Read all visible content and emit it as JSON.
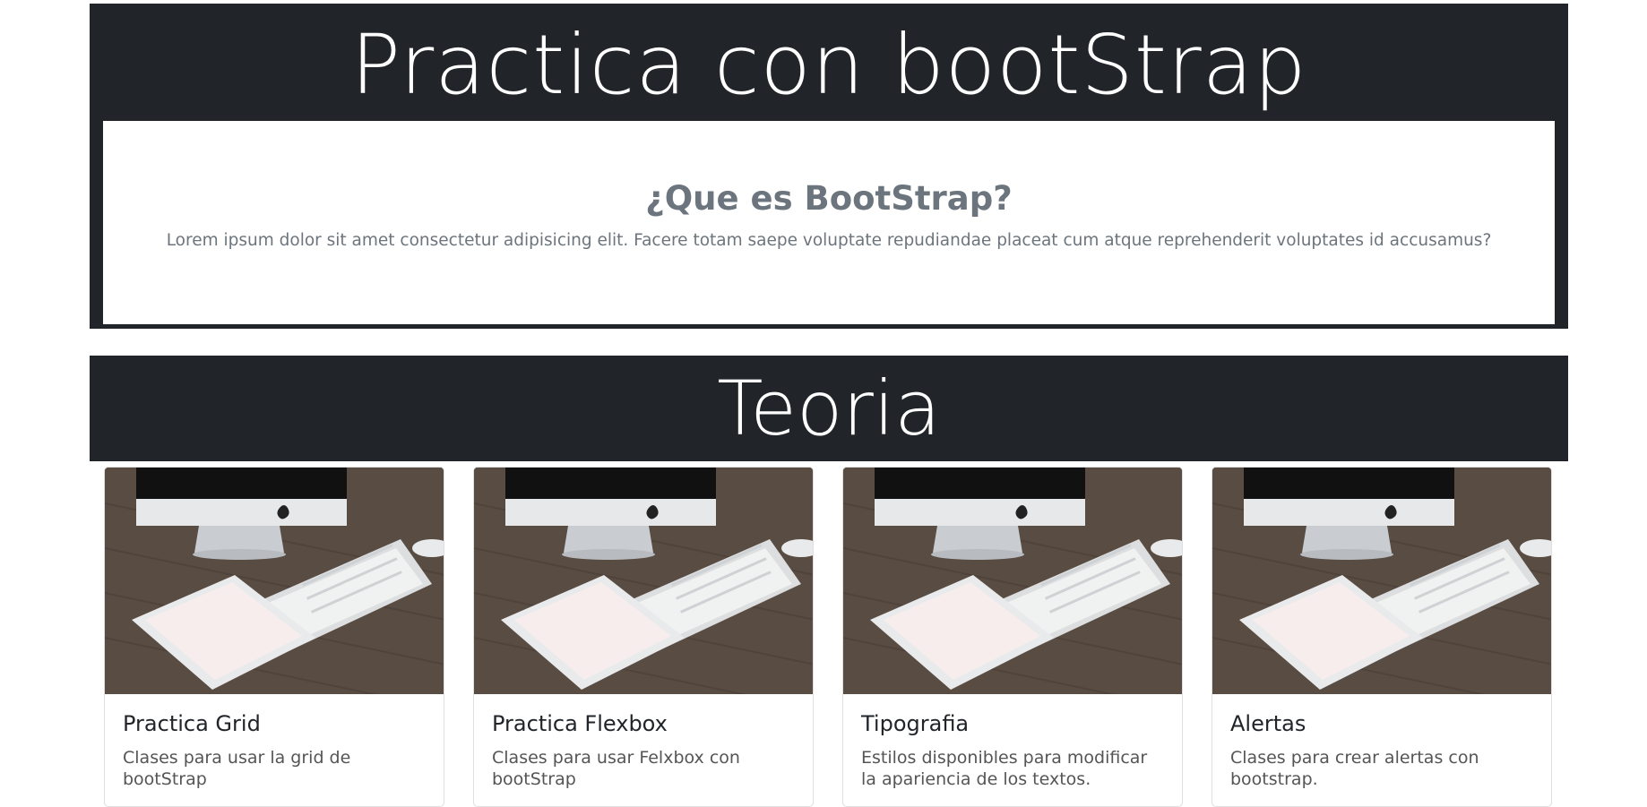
{
  "header": {
    "title": "Practica con bootStrap",
    "card_heading": "¿Que es BootStrap?",
    "card_text": "Lorem ipsum dolor sit amet consectetur adipisicing elit. Facere totam saepe voluptate repudiandae placeat cum atque reprehenderit voluptates id accusamus?"
  },
  "section": {
    "title": "Teoria"
  },
  "cards": [
    {
      "title": "Practica Grid",
      "text": "Clases para usar la grid de bootStrap",
      "image": "desk-imac-ipad-keyboard-photo"
    },
    {
      "title": "Practica Flexbox",
      "text": "Clases para usar Felxbox con bootStrap",
      "image": "desk-imac-ipad-keyboard-photo"
    },
    {
      "title": "Tipografia",
      "text": "Estilos disponibles para modificar la apariencia de los textos.",
      "image": "desk-imac-ipad-keyboard-photo"
    },
    {
      "title": "Alertas",
      "text": "Clases para crear alertas con bootstrap.",
      "image": "desk-imac-ipad-keyboard-photo"
    }
  ],
  "colors": {
    "dark_background": "#212529",
    "muted_text": "#6c757d",
    "white": "#ffffff"
  }
}
